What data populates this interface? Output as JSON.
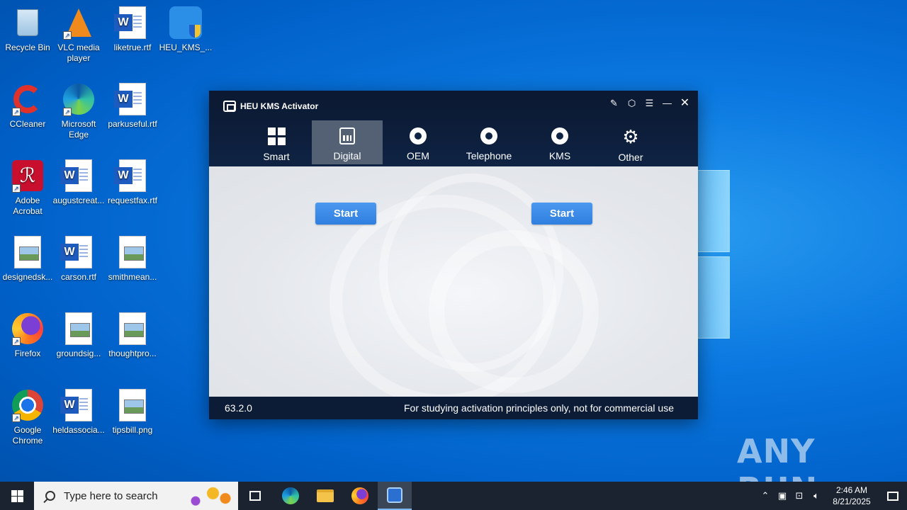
{
  "desktop": {
    "icons": [
      {
        "label": "Recycle Bin"
      },
      {
        "label": "VLC media player"
      },
      {
        "label": "liketrue.rtf"
      },
      {
        "label": "HEU_KMS_..."
      },
      {
        "label": "CCleaner"
      },
      {
        "label": "Microsoft Edge"
      },
      {
        "label": "parkuseful.rtf"
      },
      {
        "label": "Adobe Acrobat"
      },
      {
        "label": "augustcreat..."
      },
      {
        "label": "requestfax.rtf"
      },
      {
        "label": "designedsk..."
      },
      {
        "label": "carson.rtf"
      },
      {
        "label": "smithmean..."
      },
      {
        "label": "Firefox"
      },
      {
        "label": "groundsig..."
      },
      {
        "label": "thoughtpro..."
      },
      {
        "label": "Google Chrome"
      },
      {
        "label": "heldassocia..."
      },
      {
        "label": "tipsbill.png"
      }
    ]
  },
  "app": {
    "title": "HEU KMS Activator",
    "tabs": [
      {
        "label": "Smart"
      },
      {
        "label": "Digital"
      },
      {
        "label": "OEM"
      },
      {
        "label": "Telephone"
      },
      {
        "label": "KMS"
      },
      {
        "label": "Other"
      }
    ],
    "active_tab": "Digital",
    "start_left": "Start",
    "start_right": "Start",
    "version": "63.2.0",
    "footer_note": "For studying activation principles only, not for commercial use"
  },
  "watermark": "ANY RUN",
  "taskbar": {
    "search_placeholder": "Type here to search",
    "time": "2:46 AM",
    "date": "8/21/2025"
  },
  "colors": {
    "accent": "#2f7fe0",
    "header": "#0f2344",
    "active_tab": "#546073"
  }
}
